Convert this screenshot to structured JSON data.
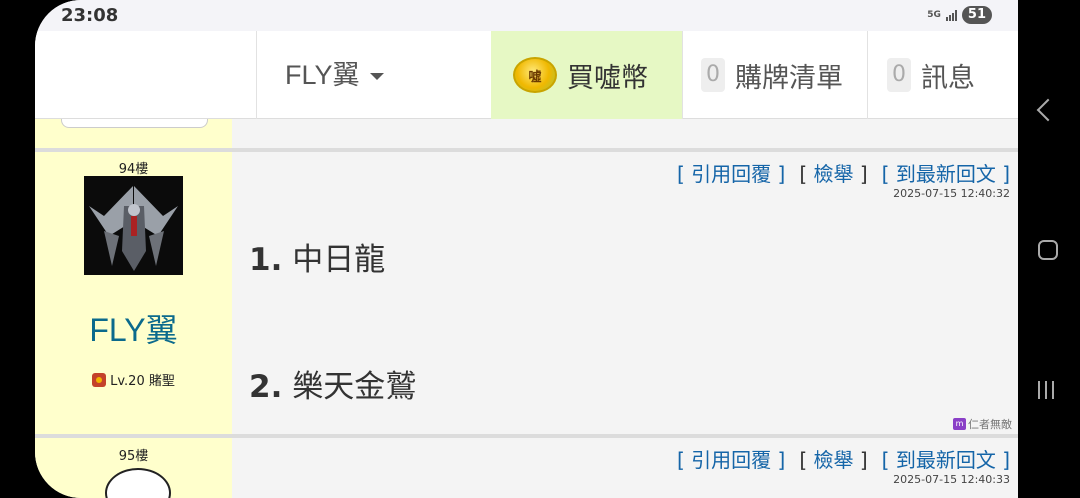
{
  "status_bar": {
    "time": "23:08",
    "network": "5G",
    "battery": "51"
  },
  "topbar": {
    "user_name": "FLY翼",
    "buy_label": "買噓幣",
    "coin_char": "噓",
    "cart_count": "0",
    "cart_label": "購牌清單",
    "msg_count": "0",
    "msg_label": "訊息"
  },
  "posts": [
    {
      "floor": "94樓",
      "user": "FLY翼",
      "level": "Lv.20 賭聖",
      "actions": {
        "quote": "[ 引用回覆 ]",
        "report": "檢舉",
        "latest": "[ 到最新回文 ]"
      },
      "timestamp": "2025-07-15 12:40:32",
      "items": [
        {
          "num": "1.",
          "text": "中日龍"
        },
        {
          "num": "2.",
          "text": "樂天金鷲"
        }
      ],
      "signature": "仁者無敵",
      "signature_icon": "m"
    },
    {
      "floor": "95樓",
      "actions": {
        "quote": "[ 引用回覆 ]",
        "report": "檢舉",
        "latest": "[ 到最新回文 ]"
      },
      "timestamp": "2025-07-15 12:40:33"
    }
  ]
}
